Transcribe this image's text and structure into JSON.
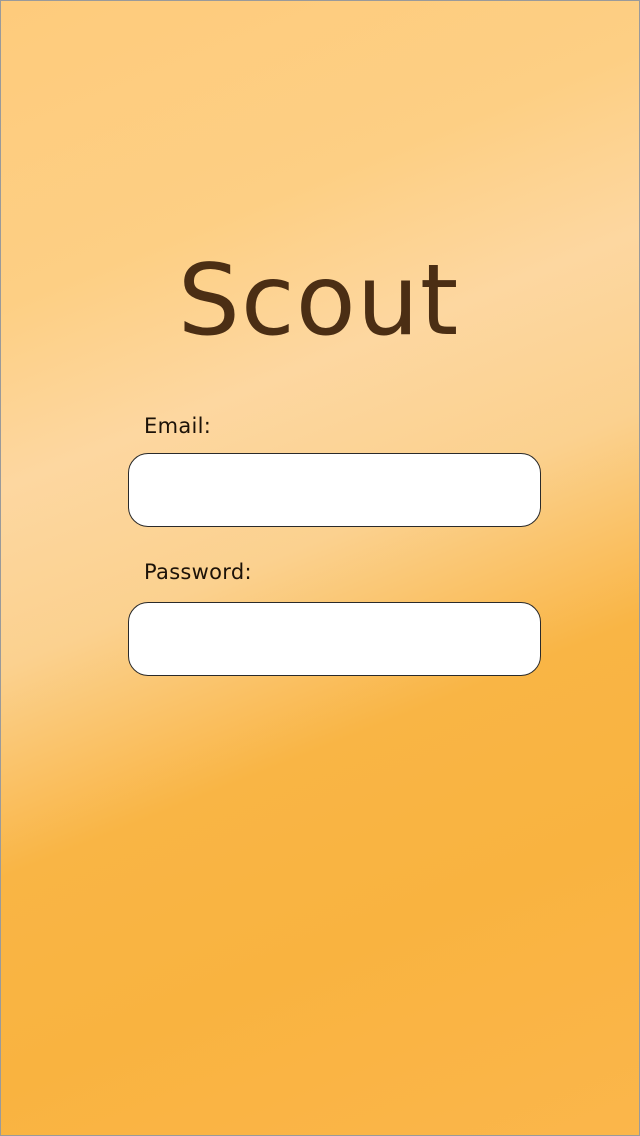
{
  "app": {
    "title": "Scout"
  },
  "form": {
    "email": {
      "label": "Email:",
      "value": "",
      "placeholder": ""
    },
    "password": {
      "label": "Password:",
      "value": "",
      "placeholder": ""
    }
  },
  "colors": {
    "title_text": "#4b2e14",
    "background_top": "#fecb7c",
    "background_bottom": "#f9b340",
    "field_background": "#ffffff"
  }
}
